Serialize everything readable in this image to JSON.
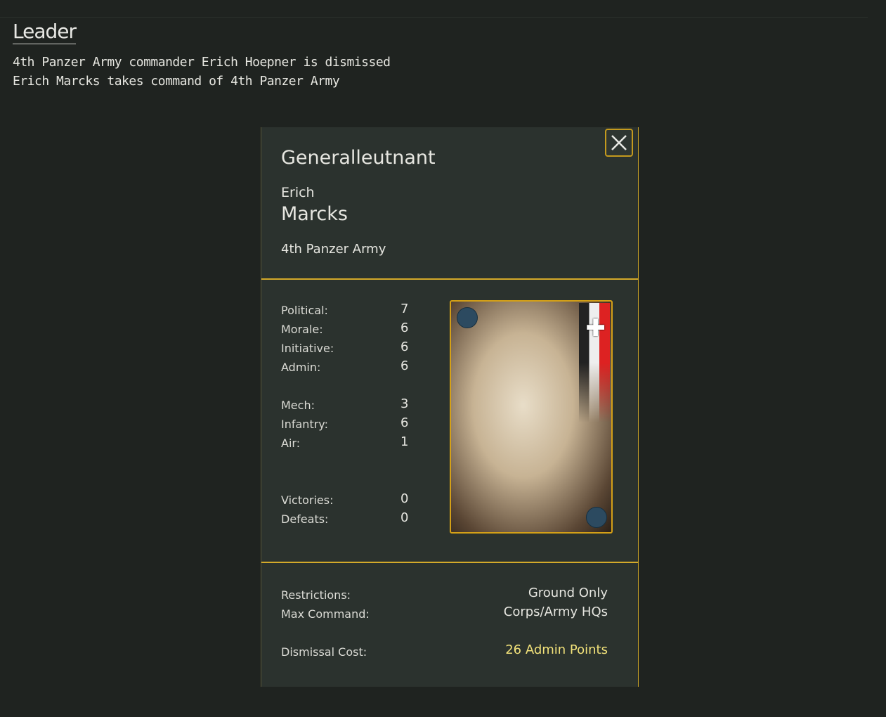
{
  "header": {
    "title": "Leader"
  },
  "log": [
    "4th Panzer Army commander Erich Hoepner is dismissed",
    "Erich Marcks takes command of 4th Panzer Army"
  ],
  "leader": {
    "rank": "Generalleutnant",
    "first_name": "Erich",
    "last_name": "Marcks",
    "command": "4th Panzer Army",
    "stats": [
      {
        "label": "Political:",
        "value": "7"
      },
      {
        "label": "Morale:",
        "value": "6"
      },
      {
        "label": "Initiative:",
        "value": "6"
      },
      {
        "label": "Admin:",
        "value": "6"
      },
      {
        "label": "Mech:",
        "value": "3"
      },
      {
        "label": "Infantry:",
        "value": "6"
      },
      {
        "label": "Air:",
        "value": "1"
      },
      {
        "label": "Victories:",
        "value": "0"
      },
      {
        "label": "Defeats:",
        "value": "0"
      }
    ],
    "restrictions_label": "Restrictions:",
    "restrictions": "Ground Only",
    "max_command_label": "Max Command:",
    "max_command": "Corps/Army HQs",
    "dismissal_label": "Dismissal Cost:",
    "dismissal_cost": "26 Admin Points"
  },
  "colors": {
    "accent": "#d4aa2a",
    "cost": "#f2e27a"
  }
}
